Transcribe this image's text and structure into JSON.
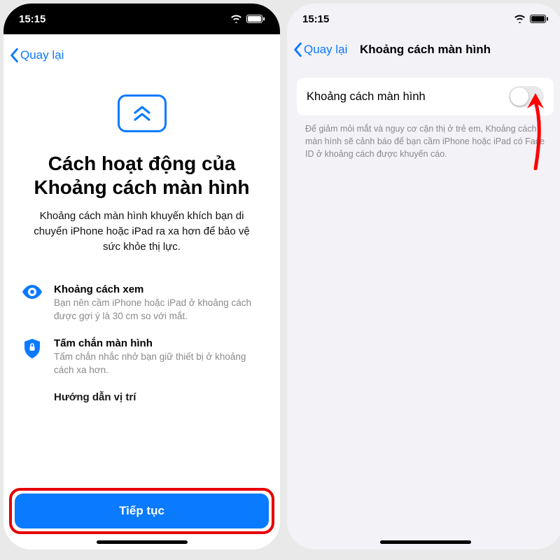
{
  "left": {
    "status_time": "15:15",
    "back_label": "Quay lại",
    "title": "Cách hoạt động của Khoảng cách màn hình",
    "description": "Khoảng cách màn hình khuyến khích bạn di chuyển iPhone hoặc iPad ra xa hơn để bảo vệ sức khỏe thị lực.",
    "features": [
      {
        "icon": "eye-icon",
        "title": "Khoảng cách xem",
        "body": "Bạn nên cầm iPhone hoặc iPad ở khoảng cách được gợi ý là 30 cm so với mắt."
      },
      {
        "icon": "shield-icon",
        "title": "Tấm chắn màn hình",
        "body": "Tấm chắn nhắc nhở bạn giữ thiết bị ở khoảng cách xa hơn."
      },
      {
        "icon": "location-icon",
        "title": "Hướng dẫn vị trí",
        "body": ""
      }
    ],
    "continue_label": "Tiếp tục"
  },
  "right": {
    "status_time": "15:15",
    "back_label": "Quay lại",
    "nav_title": "Khoảng cách màn hình",
    "cell_label": "Khoảng cách màn hình",
    "toggle_on": false,
    "footer": "Để giảm mỏi mắt và nguy cơ cận thị ở trẻ em, Khoảng cách màn hình sẽ cảnh báo để bạn cầm iPhone hoặc iPad có Face ID ở khoảng cách được khuyến cáo."
  },
  "annotations": {
    "highlight_color": "#e60000",
    "arrow_color": "#ff0000"
  }
}
